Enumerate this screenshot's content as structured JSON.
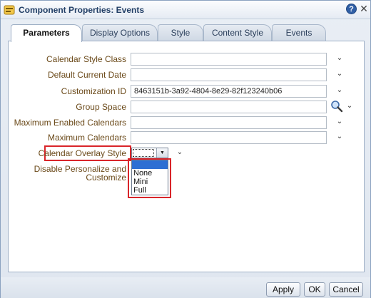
{
  "window": {
    "title": "Component Properties: Events",
    "help_label": "?",
    "close_label": "✕"
  },
  "tabs": [
    {
      "label": "Parameters",
      "active": true
    },
    {
      "label": "Display Options",
      "active": false
    },
    {
      "label": "Style",
      "active": false
    },
    {
      "label": "Content Style",
      "active": false
    },
    {
      "label": "Events",
      "active": false
    }
  ],
  "form": {
    "fields": [
      {
        "label": "Calendar Style Class",
        "value": ""
      },
      {
        "label": "Default Current Date",
        "value": ""
      },
      {
        "label": "Customization ID",
        "value": "8463151b-3a92-4804-8e29-82f123240b06"
      },
      {
        "label": "Group Space",
        "value": ""
      },
      {
        "label": "Maximum Enabled Calendars",
        "value": ""
      },
      {
        "label": "Maximum Calendars",
        "value": ""
      }
    ],
    "overlay_style": {
      "label": "Calendar Overlay Style",
      "selected_value": "",
      "options": [
        "",
        "None",
        "Mini",
        "Full"
      ]
    },
    "disable_personalize": {
      "line1": "Disable Personalize and",
      "line2": "Customize"
    },
    "chevron": "⌄"
  },
  "icons": {
    "app": "component-properties-icon",
    "help": "help-icon",
    "close": "close-icon",
    "search": "search-icon"
  },
  "colors": {
    "highlight": "#d9252a",
    "selected_option": "#2d6fd3",
    "label_text": "#6b4a1a"
  },
  "buttons": {
    "apply": "Apply",
    "ok": "OK",
    "cancel": "Cancel"
  }
}
